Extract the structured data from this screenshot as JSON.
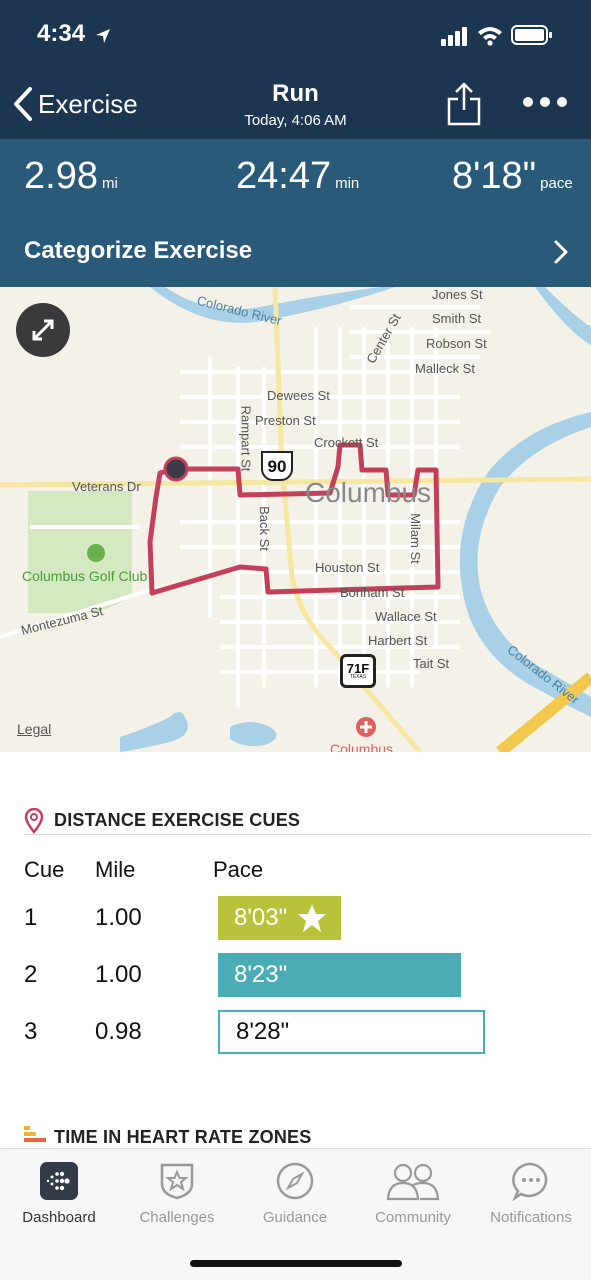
{
  "status": {
    "time": "4:34"
  },
  "nav": {
    "back_label": "Exercise",
    "title": "Run",
    "subtitle": "Today, 4:06 AM"
  },
  "stats": {
    "distance": {
      "value": "2.98",
      "unit": "mi"
    },
    "duration": {
      "value": "24:47",
      "unit": "min"
    },
    "pace": {
      "value": "8'18\"",
      "unit": "pace"
    }
  },
  "categorize": {
    "label": "Categorize Exercise"
  },
  "map": {
    "labels": {
      "colorado_river_top": "Colorado River",
      "jones": "Jones St",
      "smith": "Smith St",
      "robson": "Robson St",
      "malleck": "Malleck St",
      "center": "Center St",
      "dewees": "Dewees St",
      "preston": "Preston St",
      "crockett": "Crockett St",
      "rampart": "Rampart St",
      "veterans": "Veterans Dr",
      "columbus": "Columbus",
      "back": "Back St",
      "milam": "Milam St",
      "houston": "Houston St",
      "bonham": "Bonham St",
      "wallace": "Wallace St",
      "harbert": "Harbert St",
      "tait": "Tait St",
      "golf": "Columbus Golf Club",
      "montezuma": "Montezuma St",
      "colorado_river_right": "Colorado River",
      "columbus_hospital": "Columbus",
      "shield_90": "90",
      "shield_71": "71F",
      "shield_71_sub": "TEXAS"
    },
    "legal": "Legal"
  },
  "cues": {
    "title": "DISTANCE EXERCISE CUES",
    "headers": {
      "cue": "Cue",
      "mile": "Mile",
      "pace": "Pace"
    },
    "rows": [
      {
        "cue": "1",
        "mile": "1.00",
        "pace": "8'03\"",
        "fraction": 0.46,
        "color": "#b8c23a",
        "star": true
      },
      {
        "cue": "2",
        "mile": "1.00",
        "pace": "8'23\"",
        "fraction": 0.91,
        "color": "#4aadb5",
        "star": false
      },
      {
        "cue": "3",
        "mile": "0.98",
        "pace": "8'28\"",
        "fraction": 1.0,
        "color": "#ffffff",
        "star": false
      }
    ]
  },
  "heart": {
    "title": "TIME IN HEART RATE ZONES"
  },
  "tabs": [
    {
      "label": "Dashboard",
      "icon": "dashboard-icon",
      "active": true
    },
    {
      "label": "Challenges",
      "icon": "challenges-icon",
      "active": false
    },
    {
      "label": "Guidance",
      "icon": "guidance-icon",
      "active": false
    },
    {
      "label": "Community",
      "icon": "community-icon",
      "active": false
    },
    {
      "label": "Notifications",
      "icon": "notifications-icon",
      "active": false
    }
  ],
  "colors": {
    "header": "#1c3652",
    "stats": "#2a5a7a",
    "route": "#c4405a",
    "river": "#a8d0e6"
  }
}
